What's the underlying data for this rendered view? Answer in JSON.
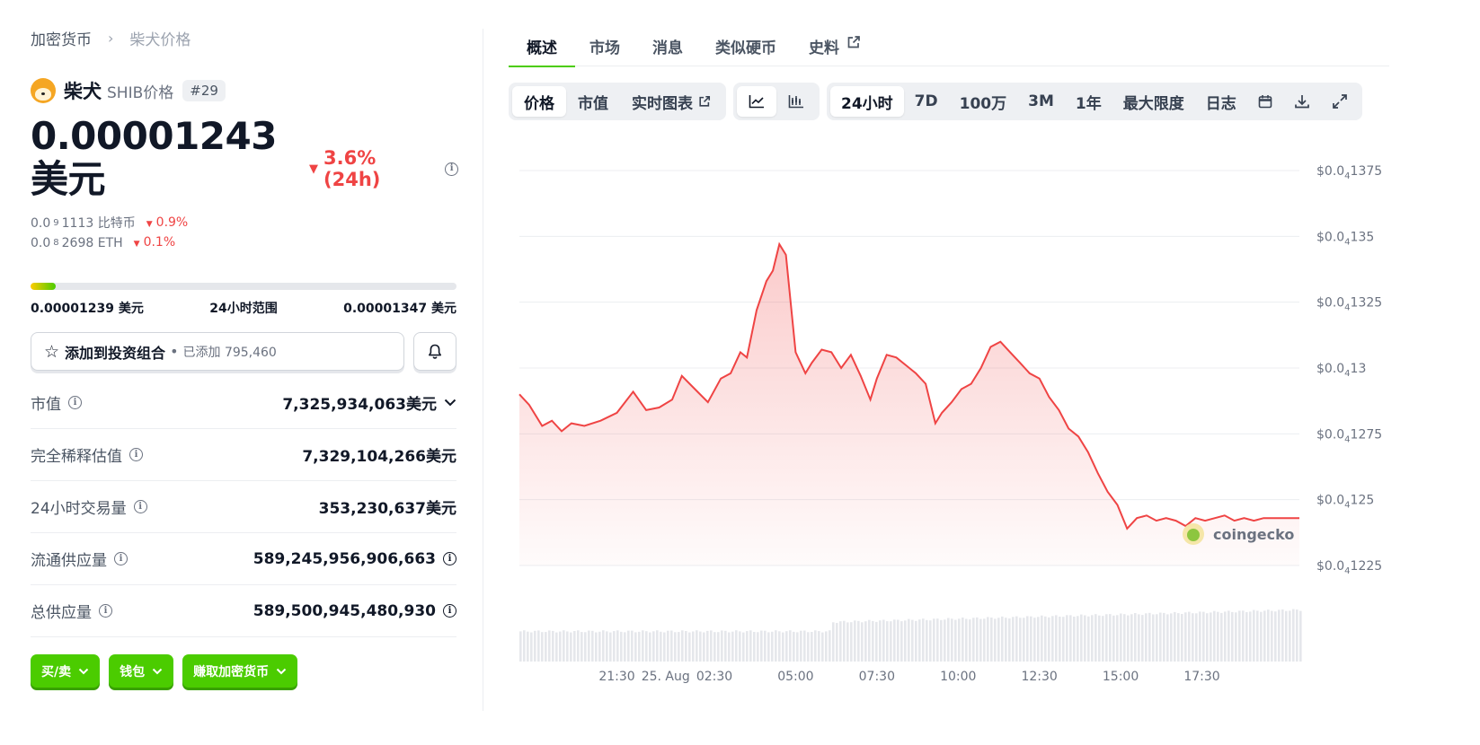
{
  "breadcrumb": {
    "parent": "加密货币",
    "separator": "›",
    "current": "柴犬价格"
  },
  "coin": {
    "name": "柴犬",
    "symbol": "SHIB价格",
    "rank": "#29",
    "price": "0.00001243美元",
    "change": "3.6% (24h)",
    "btc": {
      "prefix": "0.0",
      "sub": "9",
      "value": "1113 比特币",
      "change": "0.9%"
    },
    "eth": {
      "prefix": "0.0",
      "sub": "8",
      "value": "2698 ETH",
      "change": "0.1%"
    }
  },
  "range": {
    "low": "0.00001239 美元",
    "label": "24小时范围",
    "high": "0.00001347 美元",
    "position": 0.04
  },
  "portfolio": {
    "label": "添加到投资组合",
    "dot": "•",
    "added": "已添加 795,460"
  },
  "stats": [
    {
      "key": "市值",
      "value": "7,325,934,063美元",
      "icon": "info-icon",
      "expand": true
    },
    {
      "key": "完全稀释估值",
      "value": "7,329,104,266美元",
      "icon": "info-icon"
    },
    {
      "key": "24小时交易量",
      "value": "353,230,637美元",
      "icon": "info-icon"
    },
    {
      "key": "流通供应量",
      "value": "589,245,956,906,663",
      "icon": "info-icon",
      "value_info": true
    },
    {
      "key": "总供应量",
      "value": "589,500,945,480,930",
      "icon": "info-icon",
      "value_info": true
    }
  ],
  "cta": [
    {
      "label": "买/卖"
    },
    {
      "label": "钱包"
    },
    {
      "label": "赚取加密货币"
    }
  ],
  "tabs": [
    "概述",
    "市场",
    "消息",
    "类似硬币",
    "史料"
  ],
  "toolbar": {
    "type_options": [
      "价格",
      "市值",
      "实时图表"
    ],
    "chart_styles": [
      "line-chart-icon",
      "candlestick-icon"
    ],
    "ranges": [
      "24小时",
      "7D",
      "100万",
      "3M",
      "1年",
      "最大限度",
      "日志"
    ],
    "icons": [
      "calendar-icon",
      "download-icon",
      "expand-icon"
    ]
  },
  "colors": {
    "accent": "#4bcc00",
    "negative": "#ef4444",
    "line": "#ef4444"
  },
  "chart_data": {
    "type": "area",
    "brand": "coingecko",
    "y_ticks": [
      {
        "value": 1.375e-05,
        "prefix": "$0.0",
        "sub": "4",
        "digits": "1375"
      },
      {
        "value": 1.35e-05,
        "prefix": "$0.0",
        "sub": "4",
        "digits": "135"
      },
      {
        "value": 1.325e-05,
        "prefix": "$0.0",
        "sub": "4",
        "digits": "1325"
      },
      {
        "value": 1.3e-05,
        "prefix": "$0.0",
        "sub": "4",
        "digits": "13"
      },
      {
        "value": 1.275e-05,
        "prefix": "$0.0",
        "sub": "4",
        "digits": "1275"
      },
      {
        "value": 1.25e-05,
        "prefix": "$0.0",
        "sub": "4",
        "digits": "125"
      },
      {
        "value": 1.225e-05,
        "prefix": "$0.0",
        "sub": "4",
        "digits": "1225"
      }
    ],
    "ylim": [
      1.225e-05,
      1.375e-05
    ],
    "x_ticks": [
      {
        "label": "21:30",
        "t": 2
      },
      {
        "label": "25. Aug",
        "t": 3.5
      },
      {
        "label": "02:30",
        "t": 5
      },
      {
        "label": "05:00",
        "t": 7.5
      },
      {
        "label": "07:30",
        "t": 10
      },
      {
        "label": "10:00",
        "t": 12.5
      },
      {
        "label": "12:30",
        "t": 15
      },
      {
        "label": "15:00",
        "t": 17.5
      },
      {
        "label": "17:30",
        "t": 20
      }
    ],
    "xlim": [
      -1,
      23
    ],
    "series": [
      {
        "x": [
          -1,
          -0.7,
          -0.3,
          0,
          0.3,
          0.6,
          1,
          1.5,
          2,
          2.5,
          2.9,
          3.3,
          3.7,
          4,
          4.4,
          4.8,
          5.2,
          5.5,
          5.8,
          6,
          6.3,
          6.6,
          6.8,
          7,
          7.2,
          7.5,
          7.8,
          8,
          8.3,
          8.6,
          8.9,
          9.2,
          9.5,
          9.8,
          10,
          10.3,
          10.6,
          10.9,
          11.2,
          11.5,
          11.8,
          12,
          12.3,
          12.6,
          12.9,
          13.2,
          13.5,
          13.8,
          14.1,
          14.4,
          14.7,
          15,
          15.3,
          15.6,
          15.9,
          16.2,
          16.5,
          16.8,
          17.1,
          17.4,
          17.7,
          18,
          18.3,
          18.6,
          18.9,
          19.2,
          19.5,
          19.8,
          20.1,
          20.4,
          20.7,
          21,
          21.3,
          21.6,
          21.9,
          22.2,
          22.5,
          22.8,
          23
        ],
        "y": [
          1.29e-05,
          1.286e-05,
          1.278e-05,
          1.28e-05,
          1.276e-05,
          1.279e-05,
          1.278e-05,
          1.28e-05,
          1.283e-05,
          1.291e-05,
          1.284e-05,
          1.285e-05,
          1.288e-05,
          1.297e-05,
          1.292e-05,
          1.287e-05,
          1.296e-05,
          1.298e-05,
          1.306e-05,
          1.304e-05,
          1.322e-05,
          1.333e-05,
          1.337e-05,
          1.347e-05,
          1.343e-05,
          1.306e-05,
          1.298e-05,
          1.302e-05,
          1.307e-05,
          1.306e-05,
          1.3e-05,
          1.305e-05,
          1.297e-05,
          1.288e-05,
          1.296e-05,
          1.305e-05,
          1.304e-05,
          1.301e-05,
          1.298e-05,
          1.294e-05,
          1.279e-05,
          1.283e-05,
          1.287e-05,
          1.292e-05,
          1.294e-05,
          1.3e-05,
          1.308e-05,
          1.31e-05,
          1.306e-05,
          1.302e-05,
          1.298e-05,
          1.296e-05,
          1.289e-05,
          1.284e-05,
          1.277e-05,
          1.274e-05,
          1.268e-05,
          1.26e-05,
          1.253e-05,
          1.248e-05,
          1.239e-05,
          1.243e-05,
          1.244e-05,
          1.242e-05,
          1.243e-05,
          1.242e-05,
          1.24e-05,
          1.243e-05,
          1.242e-05,
          1.243e-05,
          1.244e-05,
          1.242e-05,
          1.243e-05,
          1.242e-05,
          1.243e-05,
          1.243e-05,
          1.243e-05,
          1.243e-05,
          1.243e-05
        ]
      }
    ],
    "volume": {
      "start": 0.42,
      "mid": 0.55,
      "end": 0.72,
      "rise_at": 0.4
    },
    "grid": true
  }
}
